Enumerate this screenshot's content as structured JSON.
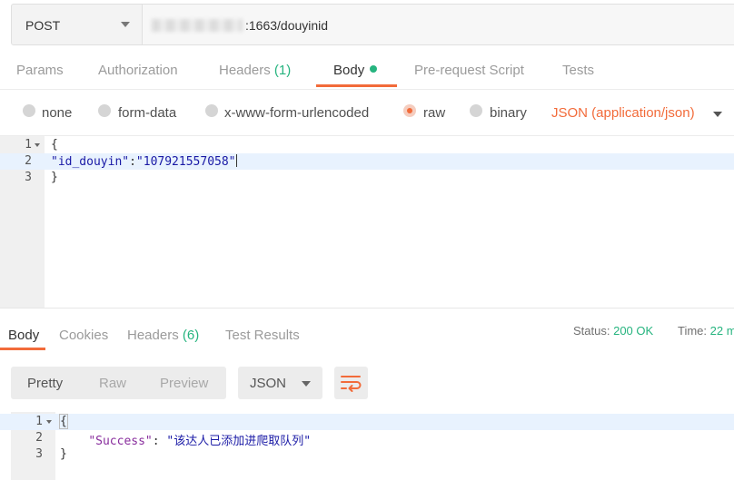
{
  "request": {
    "method": "POST",
    "url_visible": ":1663/douyinid"
  },
  "request_tabs": [
    {
      "label": "Params"
    },
    {
      "label": "Authorization"
    },
    {
      "label": "Headers",
      "count": "(1)"
    },
    {
      "label": "Body",
      "active": true,
      "indicator": "green-dot"
    },
    {
      "label": "Pre-request Script"
    },
    {
      "label": "Tests"
    }
  ],
  "body_types": [
    {
      "label": "none",
      "selected": false
    },
    {
      "label": "form-data",
      "selected": false
    },
    {
      "label": "x-www-form-urlencoded",
      "selected": false
    },
    {
      "label": "raw",
      "selected": true
    },
    {
      "label": "binary",
      "selected": false
    }
  ],
  "content_type": "JSON (application/json)",
  "request_editor": {
    "lines": [
      {
        "num": "1",
        "text": "{"
      },
      {
        "num": "2",
        "key": "\"id_douyin\"",
        "sep": ":",
        "value": "\"107921557058\""
      },
      {
        "num": "3",
        "text": "}"
      }
    ]
  },
  "response_tabs": [
    {
      "label": "Body",
      "active": true
    },
    {
      "label": "Cookies"
    },
    {
      "label": "Headers",
      "count": "(6)"
    },
    {
      "label": "Test Results"
    }
  ],
  "response_status": {
    "status_label": "Status:",
    "status_value": "200 OK",
    "time_label": "Time:",
    "time_value": "22 m"
  },
  "view_modes": [
    {
      "label": "Pretty",
      "active": true
    },
    {
      "label": "Raw"
    },
    {
      "label": "Preview"
    }
  ],
  "format": "JSON",
  "response_editor": {
    "lines": [
      {
        "num": "1",
        "text": "{"
      },
      {
        "num": "2",
        "key": "\"Success\"",
        "sep": ": ",
        "value": "\"该达人已添加进爬取队列\""
      },
      {
        "num": "3",
        "text": "}"
      }
    ]
  },
  "colors": {
    "accent": "#f26b3a",
    "success": "#26b47f",
    "json_string": "#1a1aa6",
    "json_key": "#882d9d"
  },
  "icons": [
    "chevron-down-icon",
    "radio-icon",
    "wrap-lines-icon",
    "fold-arrow-icon"
  ]
}
